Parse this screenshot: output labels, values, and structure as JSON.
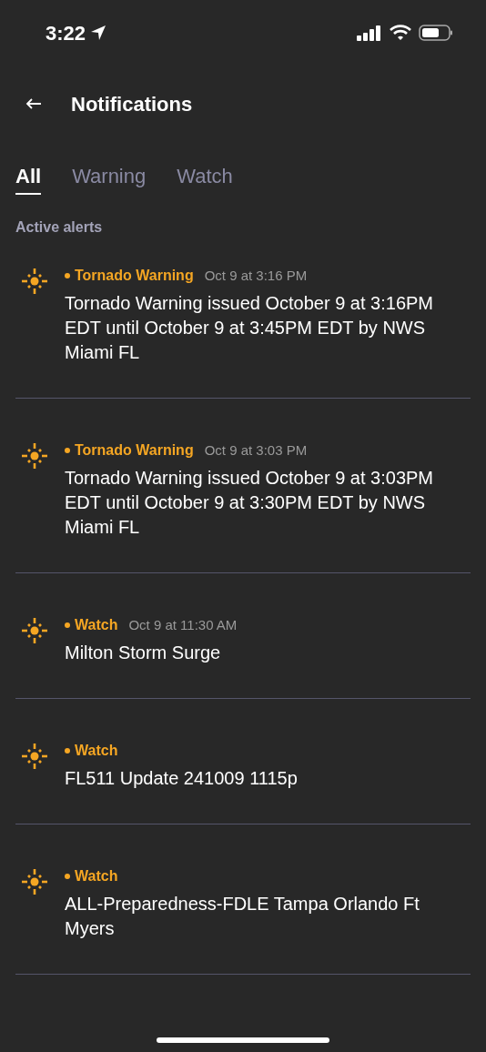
{
  "status_bar": {
    "time": "3:22"
  },
  "header": {
    "title": "Notifications"
  },
  "tabs": [
    {
      "label": "All",
      "selected": true
    },
    {
      "label": "Warning",
      "selected": false
    },
    {
      "label": "Watch",
      "selected": false
    }
  ],
  "section_title": "Active alerts",
  "alerts": [
    {
      "tag": "Tornado Warning",
      "time": "Oct 9 at 3:16 PM",
      "body": "Tornado Warning issued October 9 at 3:16PM EDT until October 9 at 3:45PM EDT by NWS Miami FL"
    },
    {
      "tag": "Tornado Warning",
      "time": "Oct 9 at 3:03 PM",
      "body": "Tornado Warning issued October 9 at 3:03PM EDT until October 9 at 3:30PM EDT by NWS Miami FL"
    },
    {
      "tag": "Watch",
      "time": "Oct 9 at 11:30 AM",
      "body": "Milton Storm Surge"
    },
    {
      "tag": "Watch",
      "body": "FL511 Update 241009 1115p"
    },
    {
      "tag": "Watch",
      "body": "ALL-Preparedness-FDLE Tampa Orlando Ft Myers"
    }
  ]
}
